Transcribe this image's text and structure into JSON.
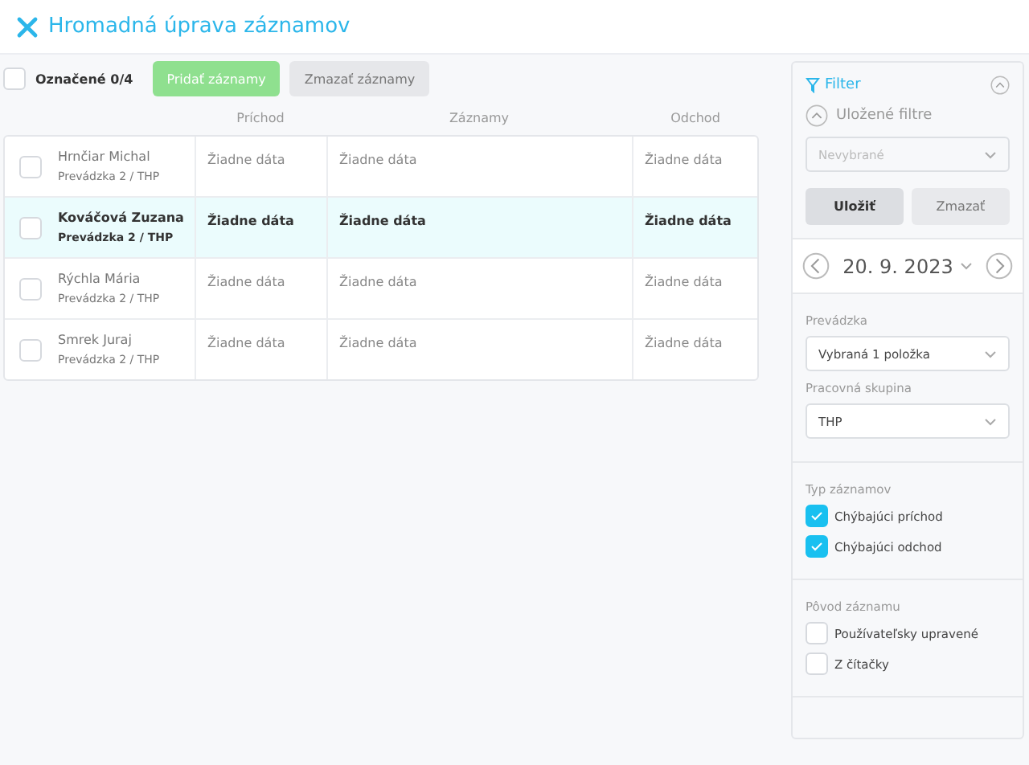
{
  "header": {
    "title": "Hromadná úprava záznamov"
  },
  "toolbar": {
    "select_all": {
      "label": "Označené 0/4",
      "checked": false
    },
    "add_button": "Pridať záznamy",
    "delete_button": "Zmazať záznamy"
  },
  "table": {
    "columns": [
      "Príchod",
      "Záznamy",
      "Odchod"
    ],
    "rows": [
      {
        "name": "Hrnčiar Michal",
        "group": "Prevádzka 2 / THP",
        "checked": false,
        "selected": false,
        "cells": [
          "Žiadne dáta",
          "Žiadne dáta",
          "Žiadne dáta"
        ]
      },
      {
        "name": "Kováčová Zuzana",
        "group": "Prevádzka 2 / THP",
        "checked": false,
        "selected": true,
        "cells": [
          "Žiadne dáta",
          "Žiadne dáta",
          "Žiadne dáta"
        ]
      },
      {
        "name": "Rýchla Mária",
        "group": "Prevádzka 2 / THP",
        "checked": false,
        "selected": false,
        "cells": [
          "Žiadne dáta",
          "Žiadne dáta",
          "Žiadne dáta"
        ]
      },
      {
        "name": "Smrek Juraj",
        "group": "Prevádzka 2 / THP",
        "checked": false,
        "selected": false,
        "cells": [
          "Žiadne dáta",
          "Žiadne dáta",
          "Žiadne dáta"
        ]
      }
    ]
  },
  "filter": {
    "title": "Filter",
    "saved_filters": {
      "label": "Uložené filtre",
      "placeholder": "Nevybrané"
    },
    "save_button": "Uložiť",
    "clear_button": "Zmazať",
    "date": "20. 9. 2023",
    "selects": [
      {
        "label": "Prevádzka",
        "value": "Vybraná 1 položka"
      },
      {
        "label": "Pracovná skupina",
        "value": "THP"
      }
    ],
    "groups": [
      {
        "title": "Typ záznamov",
        "options": [
          {
            "label": "Chýbajúci príchod",
            "checked": true
          },
          {
            "label": "Chýbajúci odchod",
            "checked": true
          }
        ]
      },
      {
        "title": "Pôvod záznamu",
        "options": [
          {
            "label": "Používateľsky upravené",
            "checked": false
          },
          {
            "label": "Z čítačky",
            "checked": false
          }
        ]
      }
    ]
  }
}
